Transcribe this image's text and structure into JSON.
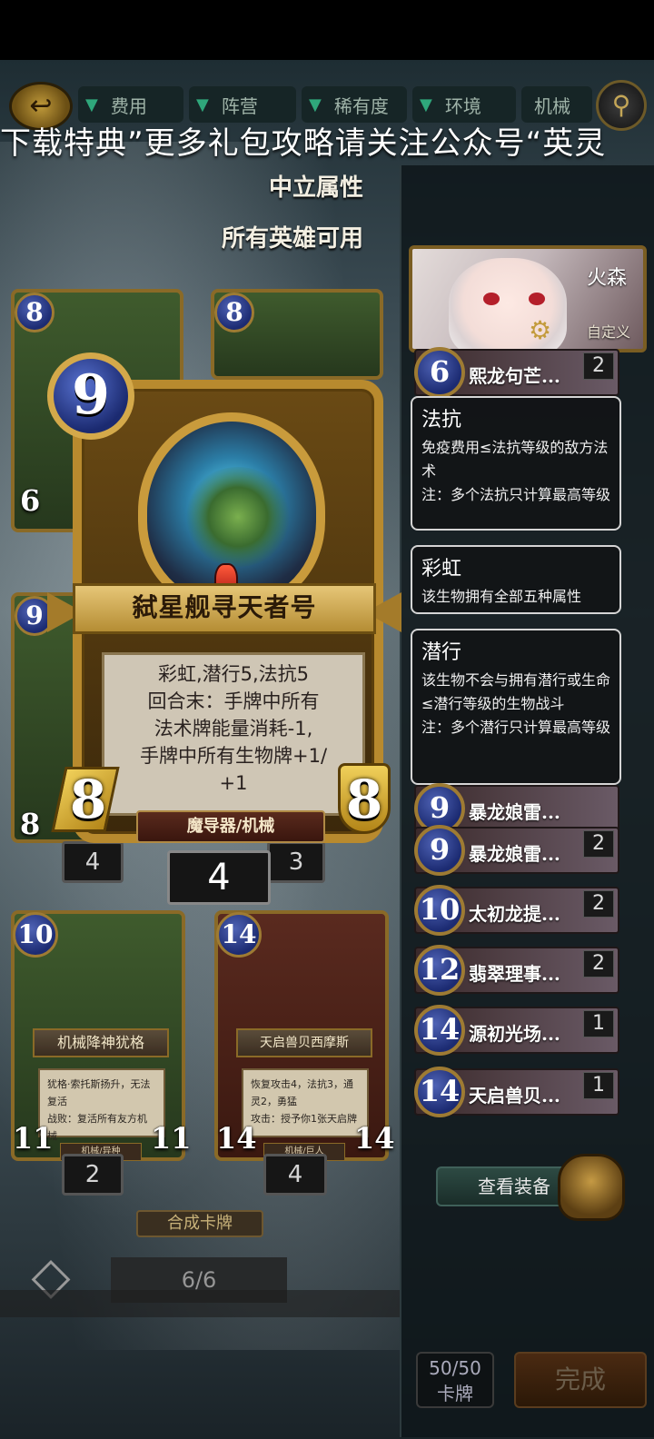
{
  "filters": {
    "cost": "费用",
    "faction": "阵营",
    "rarity": "稀有度",
    "environment": "环境",
    "machine": "机械"
  },
  "banner": "下载特典”更多礼包攻略请关注公众号“英灵",
  "attribute": {
    "neutral": "中立属性",
    "usable": "所有英雄可用"
  },
  "hero": {
    "name": "火森",
    "custom_label": "自定义"
  },
  "deck": {
    "rows_top": [
      {
        "cost": "6",
        "name": "熙龙句芒...",
        "count": "2"
      }
    ],
    "rows_bottom": [
      {
        "cost": "9",
        "name": "暴龙娘雷...",
        "count": ""
      },
      {
        "cost": "9",
        "name": "暴龙娘雷...",
        "count": "2"
      },
      {
        "cost": "10",
        "name": "太初龙提...",
        "count": "2"
      },
      {
        "cost": "12",
        "name": "翡翠理事...",
        "count": "2"
      },
      {
        "cost": "14",
        "name": "源初光场...",
        "count": "1"
      },
      {
        "cost": "14",
        "name": "天启兽贝...",
        "count": "1"
      }
    ],
    "view_equipment": "查看装备",
    "card_count": "50/50",
    "card_label": "卡牌",
    "done": "完成"
  },
  "tooltips": [
    {
      "title": "法抗",
      "body": "免疫费用≤法抗等级的敌方法术\n注：多个法抗只计算最高等级"
    },
    {
      "title": "彩虹",
      "body": "该生物拥有全部五种属性"
    },
    {
      "title": "潜行",
      "body": "该生物不会与拥有潜行或生命≤潜行等级的生物战斗\n注：多个潜行只计算最高等级"
    }
  ],
  "big_card": {
    "cost": "9",
    "name": "弑星舰寻天者号",
    "text": "彩虹,潜行5,法抗5\n回合末：手牌中所有\n法术牌能量消耗-1,\n手牌中所有生物牌+1/\n+1",
    "attack": "8",
    "health": "8",
    "tribe": "魔导器/机械",
    "count": "4"
  },
  "bg_cards": {
    "top_left": {
      "cost": "8",
      "atk": "6"
    },
    "top_right": {
      "cost": "8"
    },
    "mid_left": {
      "cost": "9",
      "atk": "8",
      "count": "4"
    },
    "mid_right": {
      "count": "3"
    },
    "card_a": {
      "cost": "10",
      "name": "机械降神犹格",
      "text": "犹格·索托斯扬升，无法复活\n战败：复活所有友方机械",
      "tribe": "机械/异种",
      "atk": "11",
      "hp": "11",
      "count": "2"
    },
    "card_b": {
      "cost": "14",
      "name": "天启兽贝西摩斯",
      "text": "恢复攻击4，法抗3，通灵2，勇猛\n攻击：授予你1张天启牌",
      "tribe": "机械/巨人",
      "atk": "14",
      "hp": "14",
      "count": "4"
    }
  },
  "craft": "合成卡牌",
  "page": "6/6"
}
